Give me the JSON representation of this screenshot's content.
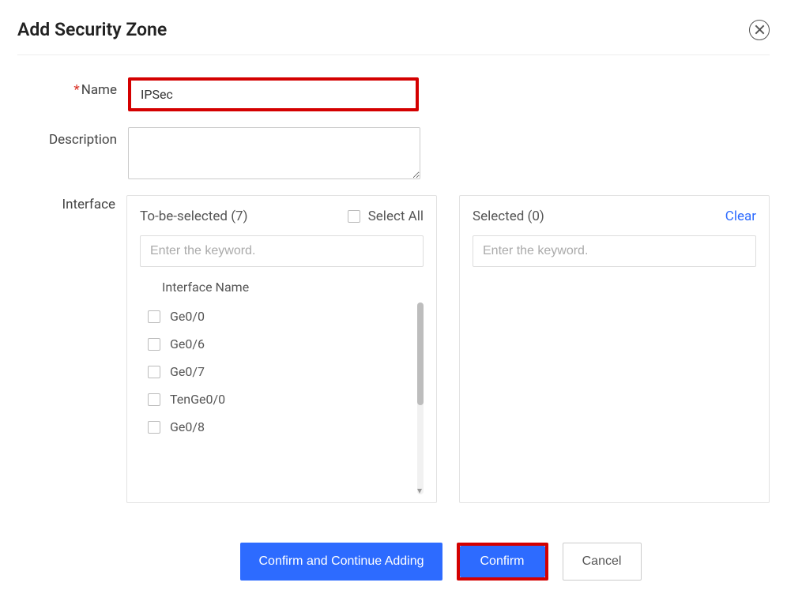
{
  "dialog": {
    "title": "Add Security Zone",
    "labels": {
      "name": "Name",
      "description": "Description",
      "interface": "Interface"
    },
    "name_value": "IPSec"
  },
  "toSelect": {
    "heading": "To-be-selected  (7)",
    "selectAll": "Select All",
    "placeholder": "Enter the keyword.",
    "colHeader": "Interface Name",
    "items": [
      "Ge0/0",
      "Ge0/6",
      "Ge0/7",
      "TenGe0/0",
      "Ge0/8"
    ]
  },
  "selected": {
    "heading": "Selected  (0)",
    "clear": "Clear",
    "placeholder": "Enter the keyword."
  },
  "footer": {
    "confirmContinue": "Confirm and Continue Adding",
    "confirm": "Confirm",
    "cancel": "Cancel"
  }
}
